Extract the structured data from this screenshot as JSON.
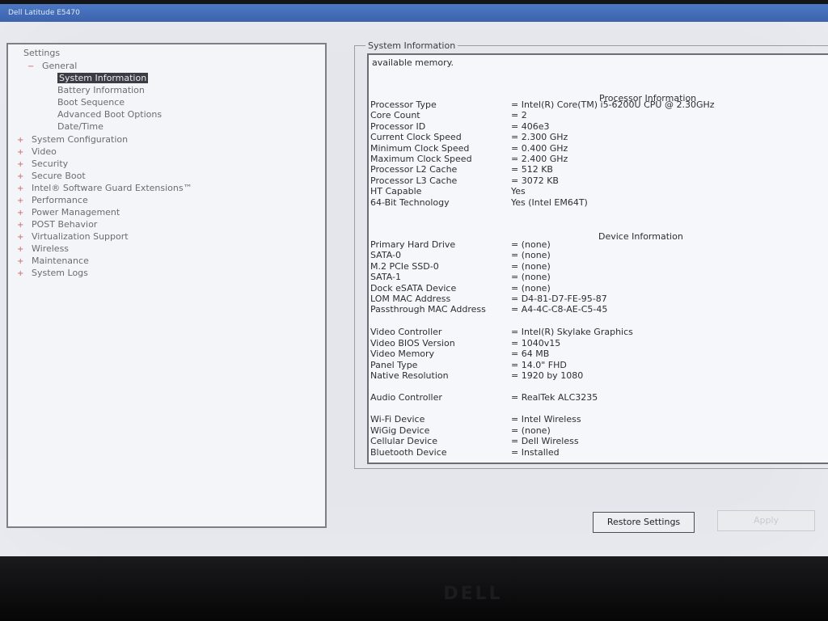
{
  "window": {
    "title": "Dell Latitude E5470"
  },
  "tree": {
    "root": "Settings",
    "items": [
      {
        "label": "General",
        "pm": "−"
      },
      {
        "label": "System Information"
      },
      {
        "label": "Battery Information"
      },
      {
        "label": "Boot Sequence"
      },
      {
        "label": "Advanced Boot Options"
      },
      {
        "label": "Date/Time"
      },
      {
        "label": "System Configuration",
        "pm": "+"
      },
      {
        "label": "Video",
        "pm": "+"
      },
      {
        "label": "Security",
        "pm": "+"
      },
      {
        "label": "Secure Boot",
        "pm": "+"
      },
      {
        "label": "Intel® Software Guard Extensions™",
        "pm": "+"
      },
      {
        "label": "Performance",
        "pm": "+"
      },
      {
        "label": "Power Management",
        "pm": "+"
      },
      {
        "label": "POST Behavior",
        "pm": "+"
      },
      {
        "label": "Virtualization Support",
        "pm": "+"
      },
      {
        "label": "Wireless",
        "pm": "+"
      },
      {
        "label": "Maintenance",
        "pm": "+"
      },
      {
        "label": "System Logs",
        "pm": "+"
      }
    ]
  },
  "panel": {
    "group_title": "System Information",
    "top_text": "available memory.",
    "processor_heading": "Processor Information",
    "processor": [
      {
        "key": "Processor Type",
        "value": "= Intel(R) Core(TM) i5-6200U CPU @ 2.30GHz"
      },
      {
        "key": "Core Count",
        "value": "= 2"
      },
      {
        "key": "Processor ID",
        "value": "= 406e3"
      },
      {
        "key": "Current Clock Speed",
        "value": "= 2.300 GHz"
      },
      {
        "key": "Minimum Clock Speed",
        "value": "= 0.400 GHz"
      },
      {
        "key": "Maximum Clock Speed",
        "value": "= 2.400 GHz"
      },
      {
        "key": "Processor L2 Cache",
        "value": "= 512 KB"
      },
      {
        "key": "Processor L3 Cache",
        "value": "= 3072 KB"
      },
      {
        "key": "HT Capable",
        "value": "Yes"
      },
      {
        "key": "64-Bit Technology",
        "value": "Yes (Intel EM64T)"
      }
    ],
    "device_heading": "Device Information",
    "devices": [
      {
        "key": "Primary Hard Drive",
        "value": "= (none)"
      },
      {
        "key": "SATA-0",
        "value": "= (none)"
      },
      {
        "key": "M.2 PCIe SSD-0",
        "value": "= (none)"
      },
      {
        "key": "SATA-1",
        "value": "= (none)"
      },
      {
        "key": "Dock eSATA Device",
        "value": "= (none)"
      },
      {
        "key": "LOM MAC Address",
        "value": "= D4-81-D7-FE-95-87"
      },
      {
        "key": "Passthrough MAC Address",
        "value": "= A4-4C-C8-AE-C5-45"
      }
    ],
    "video": [
      {
        "key": "Video Controller",
        "value": "= Intel(R) Skylake Graphics"
      },
      {
        "key": "Video BIOS Version",
        "value": "= 1040v15"
      },
      {
        "key": "Video Memory",
        "value": "= 64 MB"
      },
      {
        "key": "Panel Type",
        "value": "= 14.0\" FHD"
      },
      {
        "key": "Native Resolution",
        "value": "= 1920 by 1080"
      }
    ],
    "audio": [
      {
        "key": "Audio Controller",
        "value": "= RealTek ALC3235"
      }
    ],
    "wireless": [
      {
        "key": "Wi-Fi Device",
        "value": "= Intel Wireless"
      },
      {
        "key": "WiGig Device",
        "value": "= (none)"
      },
      {
        "key": "Cellular Device",
        "value": "= Dell Wireless"
      },
      {
        "key": "Bluetooth Device",
        "value": "= Installed"
      }
    ]
  },
  "buttons": {
    "restore": "Restore Settings",
    "apply": "Apply"
  },
  "bezel": {
    "logo": "DELL"
  }
}
